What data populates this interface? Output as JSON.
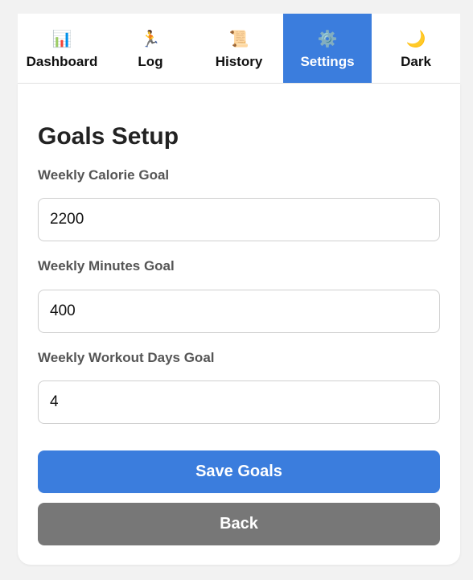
{
  "nav": {
    "tabs": [
      {
        "icon": "bar-chart-icon",
        "glyph": "📊",
        "label": "Dashboard",
        "active": false
      },
      {
        "icon": "runner-icon",
        "glyph": "🏃",
        "label": "Log",
        "active": false
      },
      {
        "icon": "scroll-icon",
        "glyph": "📜",
        "label": "History",
        "active": false
      },
      {
        "icon": "gear-icon",
        "glyph": "⚙️",
        "label": "Settings",
        "active": true
      },
      {
        "icon": "moon-icon",
        "glyph": "🌙",
        "label": "Dark",
        "active": false
      }
    ]
  },
  "goals": {
    "title": "Goals Setup",
    "fields": [
      {
        "label": "Weekly Calorie Goal",
        "value": "2200"
      },
      {
        "label": "Weekly Minutes Goal",
        "value": "400"
      },
      {
        "label": "Weekly Workout Days Goal",
        "value": "4"
      }
    ],
    "save_label": "Save Goals",
    "back_label": "Back"
  },
  "colors": {
    "accent": "#3b7ddd",
    "secondary_button": "#777777",
    "page_background": "#f2f2f2"
  }
}
